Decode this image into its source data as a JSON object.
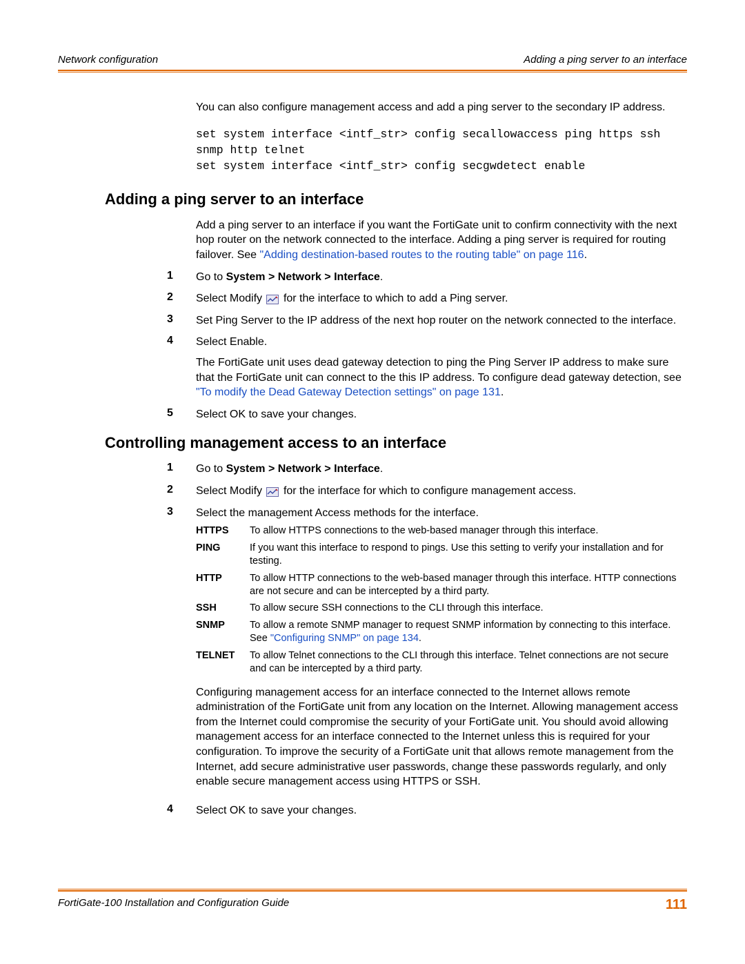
{
  "header": {
    "left": "Network configuration",
    "right": "Adding a ping server to an interface"
  },
  "introPara": "You can also configure management access and add a ping server to the secondary IP address.",
  "codeBlock": "set system interface <intf_str> config secallowaccess ping https ssh snmp http telnet\nset system interface <intf_str> config secgwdetect enable",
  "sectionA": {
    "title": "Adding a ping server to an interface",
    "para_before_link": "Add a ping server to an interface if you want the FortiGate unit to confirm connectivity with the next hop router on the network connected to the interface. Adding a ping server is required for routing failover. See ",
    "link_text": "\"Adding destination-based routes to the routing table\" on page 116",
    "para_after_link": ".",
    "steps": [
      {
        "n": "1",
        "goto_prefix": "Go to ",
        "goto_path": "System > Network > Interface",
        "goto_suffix": "."
      },
      {
        "n": "2",
        "before_icon": "Select Modify ",
        "after_icon": " for the interface to which to add a Ping server."
      },
      {
        "n": "3",
        "text": "Set Ping Server to the IP address of the next hop router on the network connected to the interface."
      },
      {
        "n": "4",
        "text": "Select Enable.",
        "sub_before": "The FortiGate unit uses dead gateway detection to ping the Ping Server IP address to make sure that the FortiGate unit can connect to the this IP address. To configure dead gateway detection, see ",
        "sub_link": "\"To modify the Dead Gateway Detection settings\" on page 131",
        "sub_after": "."
      },
      {
        "n": "5",
        "text": "Select OK to save your changes."
      }
    ]
  },
  "sectionB": {
    "title": "Controlling management access to an interface",
    "steps_top": [
      {
        "n": "1",
        "goto_prefix": "Go to ",
        "goto_path": "System > Network > Interface",
        "goto_suffix": "."
      },
      {
        "n": "2",
        "before_icon": "Select Modify ",
        "after_icon": " for the interface for which to configure management access."
      },
      {
        "n": "3",
        "text": "Select the management Access methods for the interface."
      }
    ],
    "access": [
      {
        "label": "HTTPS",
        "desc": "To allow HTTPS connections to the web-based manager through this interface."
      },
      {
        "label": "PING",
        "desc": "If you want this interface to respond to pings. Use this setting to verify your installation and for testing."
      },
      {
        "label": "HTTP",
        "desc": "To allow HTTP connections to the web-based manager through this interface. HTTP connections are not secure and can be intercepted by a third party."
      },
      {
        "label": "SSH",
        "desc": "To allow secure SSH connections to the CLI through this interface."
      },
      {
        "label": "SNMP",
        "desc_before": "To allow a remote SNMP manager to request SNMP information by connecting to this interface. See ",
        "link": "\"Configuring SNMP\" on page 134",
        "desc_after": "."
      },
      {
        "label": "TELNET",
        "desc": "To allow Telnet connections to the CLI through this interface. Telnet connections are not secure and can be intercepted by a third party."
      }
    ],
    "after_para": "Configuring management access for an interface connected to the Internet allows remote administration of the FortiGate unit from any location on the Internet. Allowing management access from the Internet could compromise the security of your FortiGate unit. You should avoid allowing management access for an interface connected to the Internet unless this is required for your configuration. To improve the security of a FortiGate unit that allows remote management from the Internet, add secure administrative user passwords, change these passwords regularly, and only enable secure management access using HTTPS or SSH.",
    "step4": {
      "n": "4",
      "text": "Select OK to save your changes."
    }
  },
  "footer": {
    "left": "FortiGate-100 Installation and Configuration Guide",
    "page": "111"
  }
}
